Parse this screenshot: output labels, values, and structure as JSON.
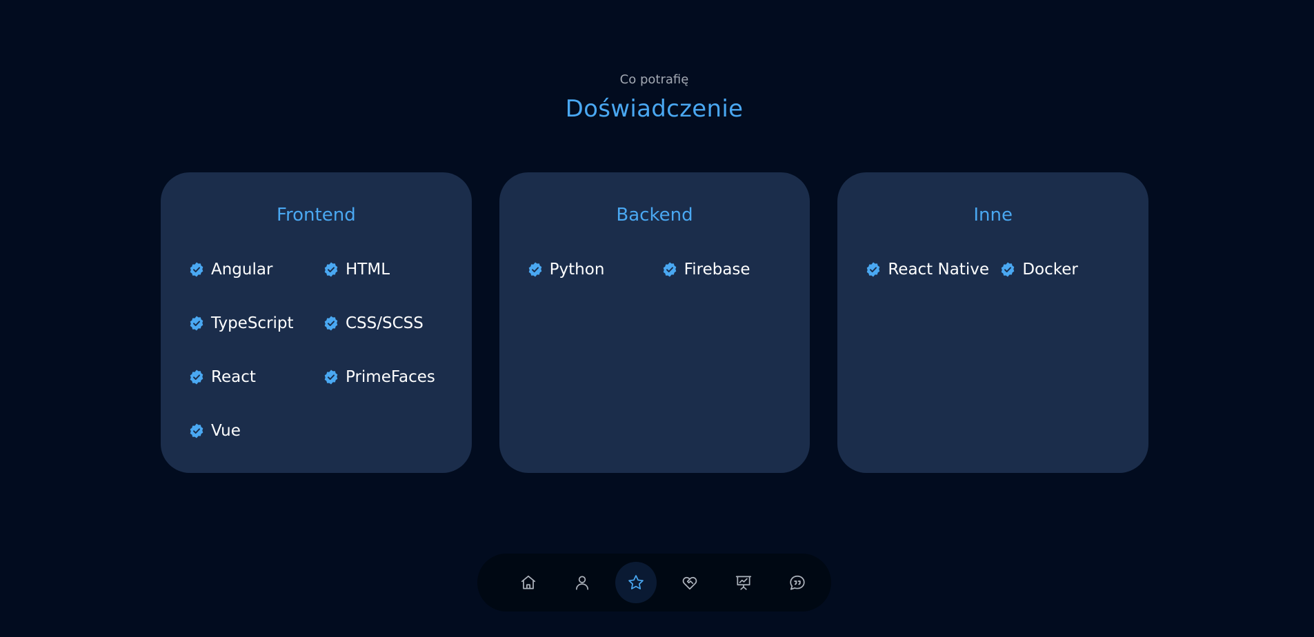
{
  "header": {
    "subtitle": "Co potrafię",
    "title": "Doświadczenie"
  },
  "cards": [
    {
      "title": "Frontend",
      "skills": [
        "Angular",
        "HTML",
        "TypeScript",
        "CSS/SCSS",
        "React",
        "PrimeFaces",
        "Vue"
      ]
    },
    {
      "title": "Backend",
      "skills": [
        "Python",
        "Firebase"
      ]
    },
    {
      "title": "Inne",
      "skills": [
        "React Native",
        "Docker"
      ]
    }
  ],
  "skill_icon": "verified-check-icon",
  "nav": {
    "items": [
      {
        "icon": "home-icon",
        "active": false
      },
      {
        "icon": "user-icon",
        "active": false
      },
      {
        "icon": "star-icon",
        "active": true
      },
      {
        "icon": "heart-handshake-icon",
        "active": false
      },
      {
        "icon": "presentation-chart-icon",
        "active": false
      },
      {
        "icon": "quote-bubble-icon",
        "active": false
      }
    ]
  },
  "colors": {
    "background": "#020c1f",
    "card": "#1b2d4b",
    "accent": "#4aa8f2",
    "text": "#ffffff",
    "muted": "#a3a9b3"
  }
}
